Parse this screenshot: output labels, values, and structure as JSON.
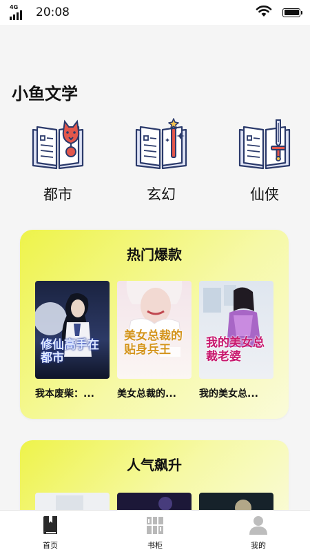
{
  "status_bar": {
    "network": "4G",
    "time": "20:08",
    "signal_icon": "cellular-signal-icon",
    "wifi_icon": "wifi-icon",
    "battery_icon": "battery-icon",
    "battery_level": 1.0
  },
  "app_title": "小鱼文学",
  "categories": [
    {
      "label": "都市",
      "icon": "book-dog-icon"
    },
    {
      "label": "玄幻",
      "icon": "book-wand-icon"
    },
    {
      "label": "仙侠",
      "icon": "book-sword-icon"
    }
  ],
  "sections": [
    {
      "title": "热门爆款",
      "books": [
        {
          "title": "我本废柴：...",
          "cover_text": "修仙高手在都市"
        },
        {
          "title": "美女总裁的...",
          "cover_text": "美女总裁的贴身兵王"
        },
        {
          "title": "我的美女总...",
          "cover_text": "我的美女总裁老婆"
        }
      ]
    },
    {
      "title": "人气飙升",
      "books": [
        {
          "title": ""
        },
        {
          "title": ""
        },
        {
          "title": ""
        }
      ]
    }
  ],
  "tab_bar": {
    "items": [
      {
        "label": "首页",
        "icon": "book-home-icon",
        "active": true
      },
      {
        "label": "书柜",
        "icon": "bookshelf-icon",
        "active": false
      },
      {
        "label": "我的",
        "icon": "profile-icon",
        "active": false
      }
    ]
  },
  "colors": {
    "section_gradient_start": "#eef34a",
    "section_gradient_end": "#fafbd9",
    "icon_outline": "#2b3a6b",
    "icon_fill": "#dfe3f5",
    "icon_accent": "#e2574c"
  }
}
